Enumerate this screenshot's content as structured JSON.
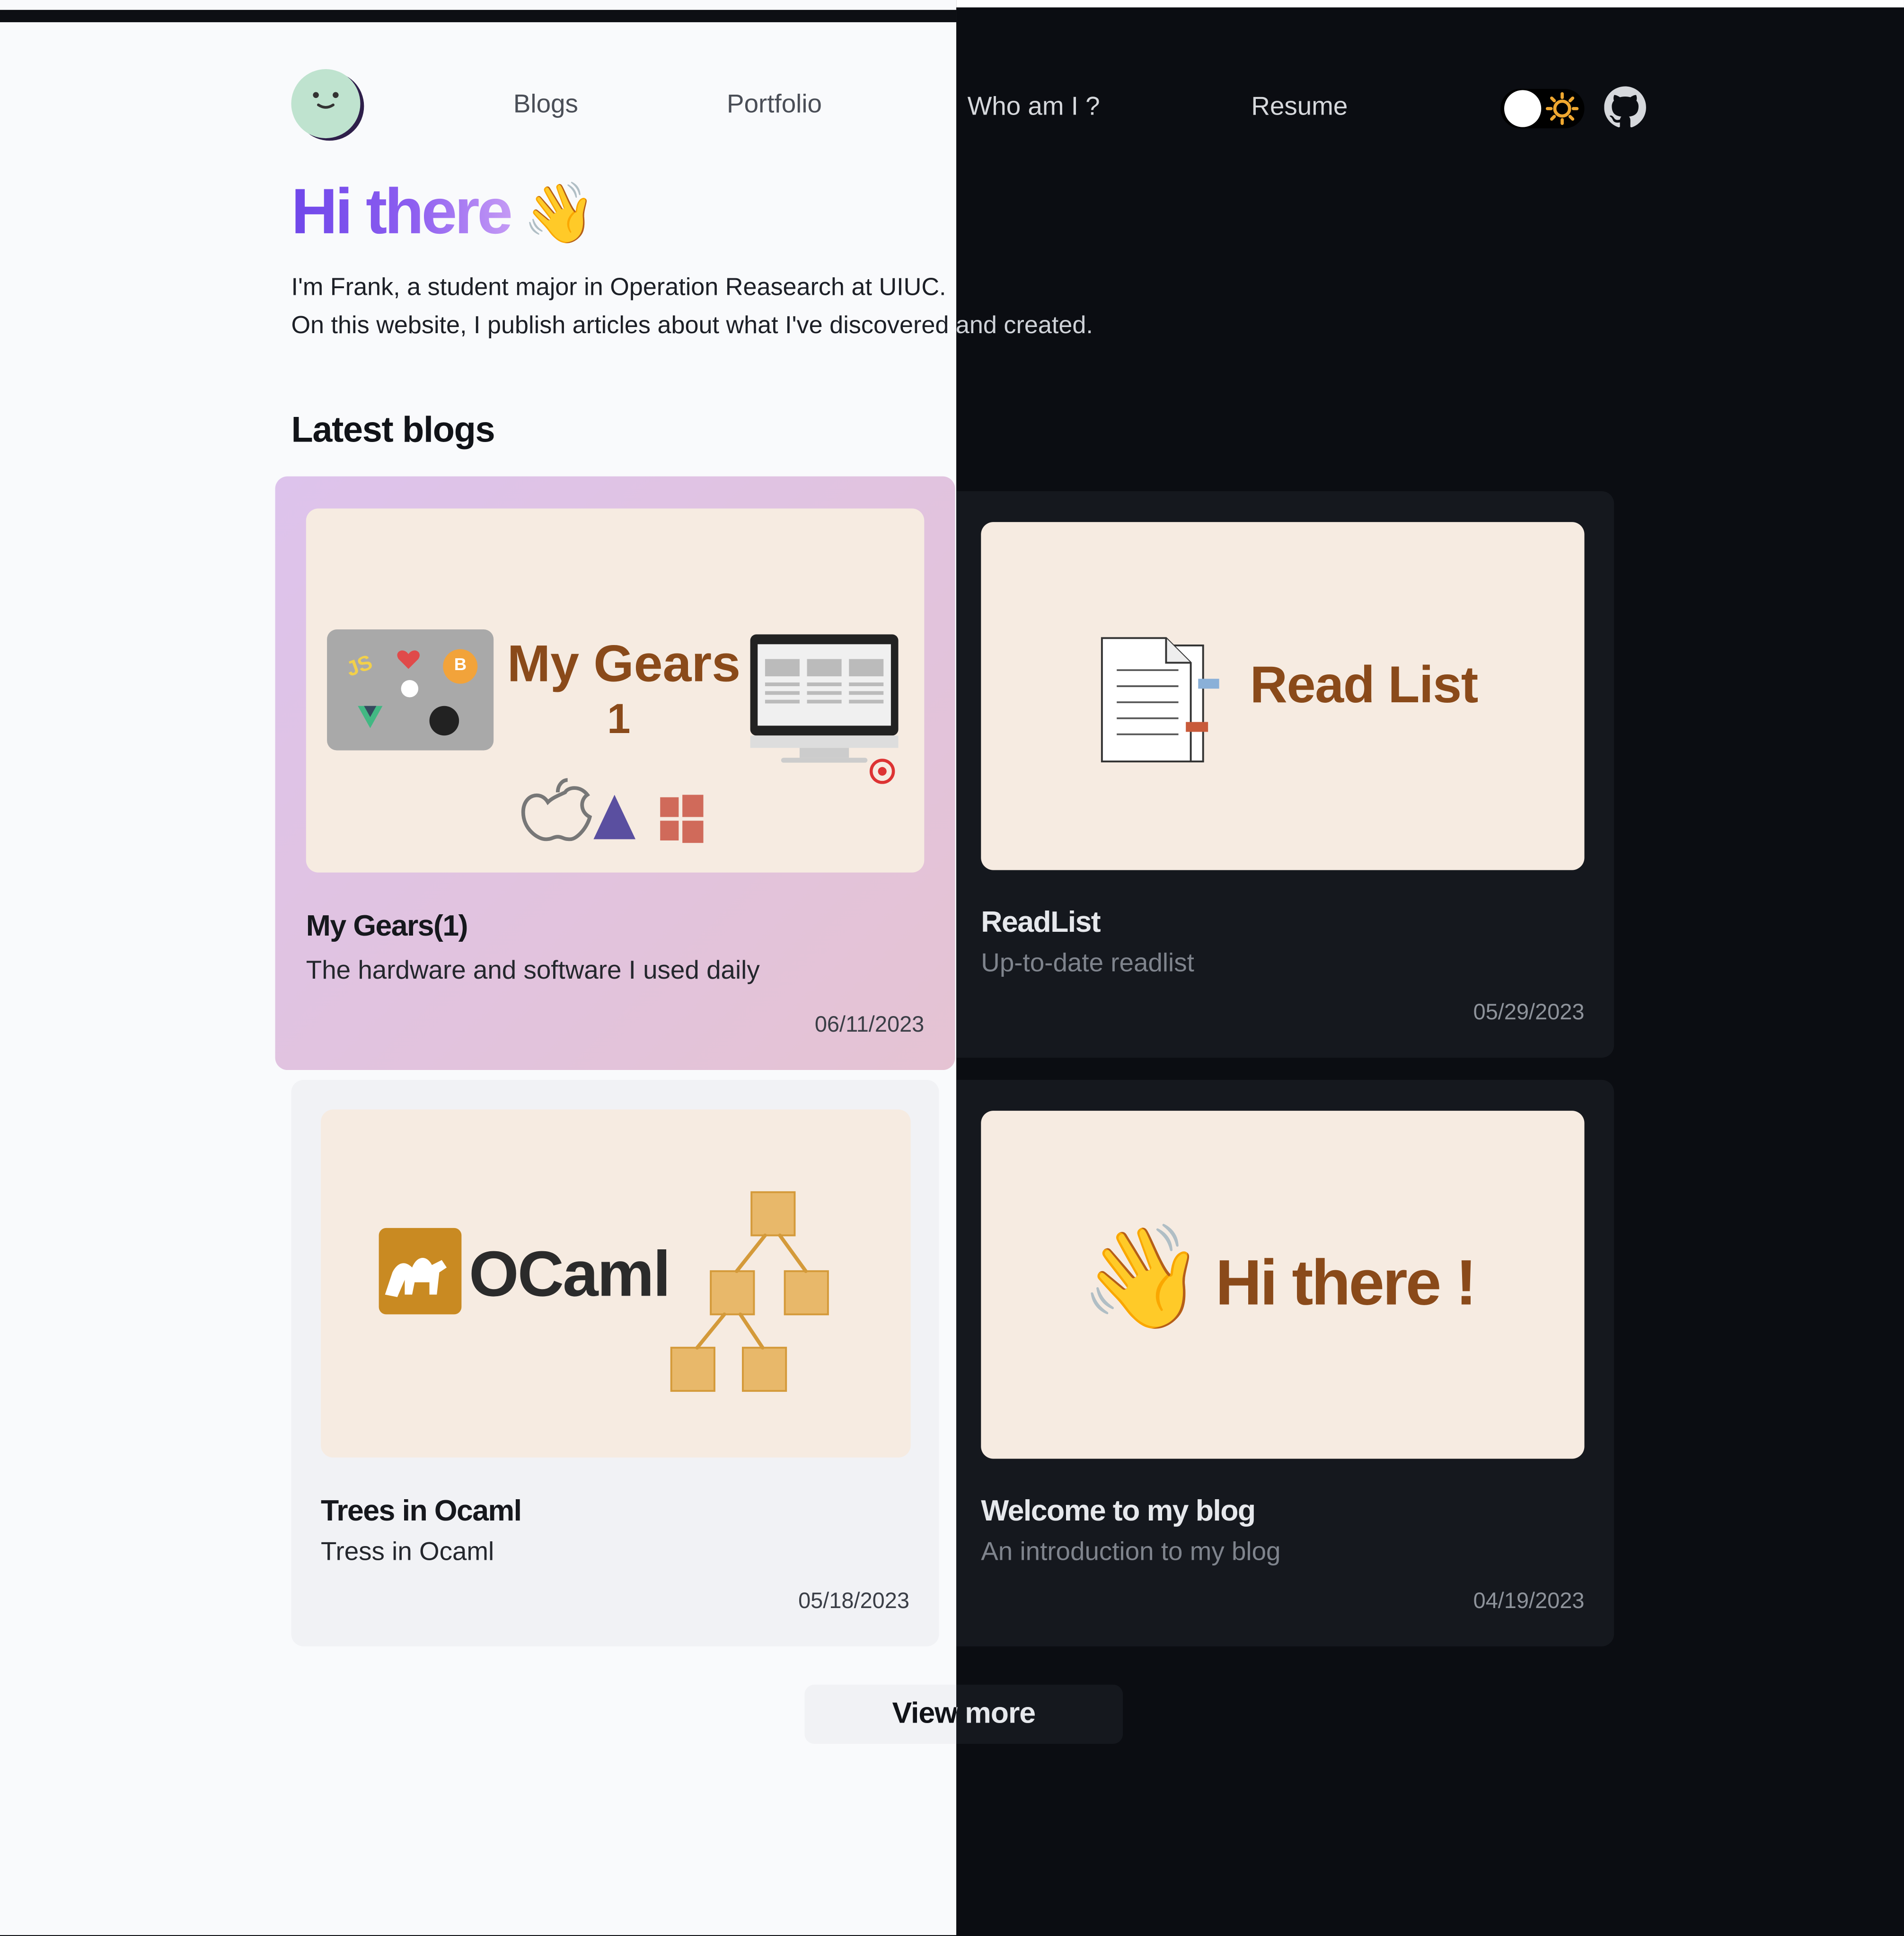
{
  "nav": {
    "links": [
      "Blogs",
      "Portfolio",
      "Who am I ?",
      "Resume"
    ],
    "avatar_icon": "smiley-avatar-icon",
    "theme_toggle_icon": "sun-icon",
    "github_icon": "github-icon"
  },
  "hero": {
    "title": "Hi there",
    "emoji": "👋",
    "line1": "I'm Frank, a student major in Operation Reasearch at UIUC.",
    "line2": "On this website, I publish articles about what I've discovered and created."
  },
  "latest_blogs": {
    "heading": "Latest blogs",
    "posts": [
      {
        "title": "My Gears(1)",
        "description": "The hardware and software I used daily",
        "date": "06/11/2023",
        "thumb": {
          "headline": "My Gears",
          "number": "1",
          "badges": [
            "JS",
            "B"
          ]
        }
      },
      {
        "title": "ReadList",
        "description": "Up-to-date readlist",
        "date": "05/29/2023",
        "thumb": {
          "headline": "Read List"
        }
      },
      {
        "title": "Trees in Ocaml",
        "description": "Tress in Ocaml",
        "date": "05/18/2023",
        "thumb": {
          "headline": "OCaml"
        }
      },
      {
        "title": "Welcome to my blog",
        "description": "An introduction to my blog",
        "date": "04/19/2023",
        "thumb": {
          "headline": "Hi there !",
          "emoji": "👋"
        }
      }
    ],
    "view_more": "View more"
  },
  "colors": {
    "light_bg": "#f9fafc",
    "dark_bg": "#0b0d12",
    "accent": "#6f47ea",
    "thumb_bg": "#f6ebe1",
    "thumb_text": "#8a4a1a"
  }
}
